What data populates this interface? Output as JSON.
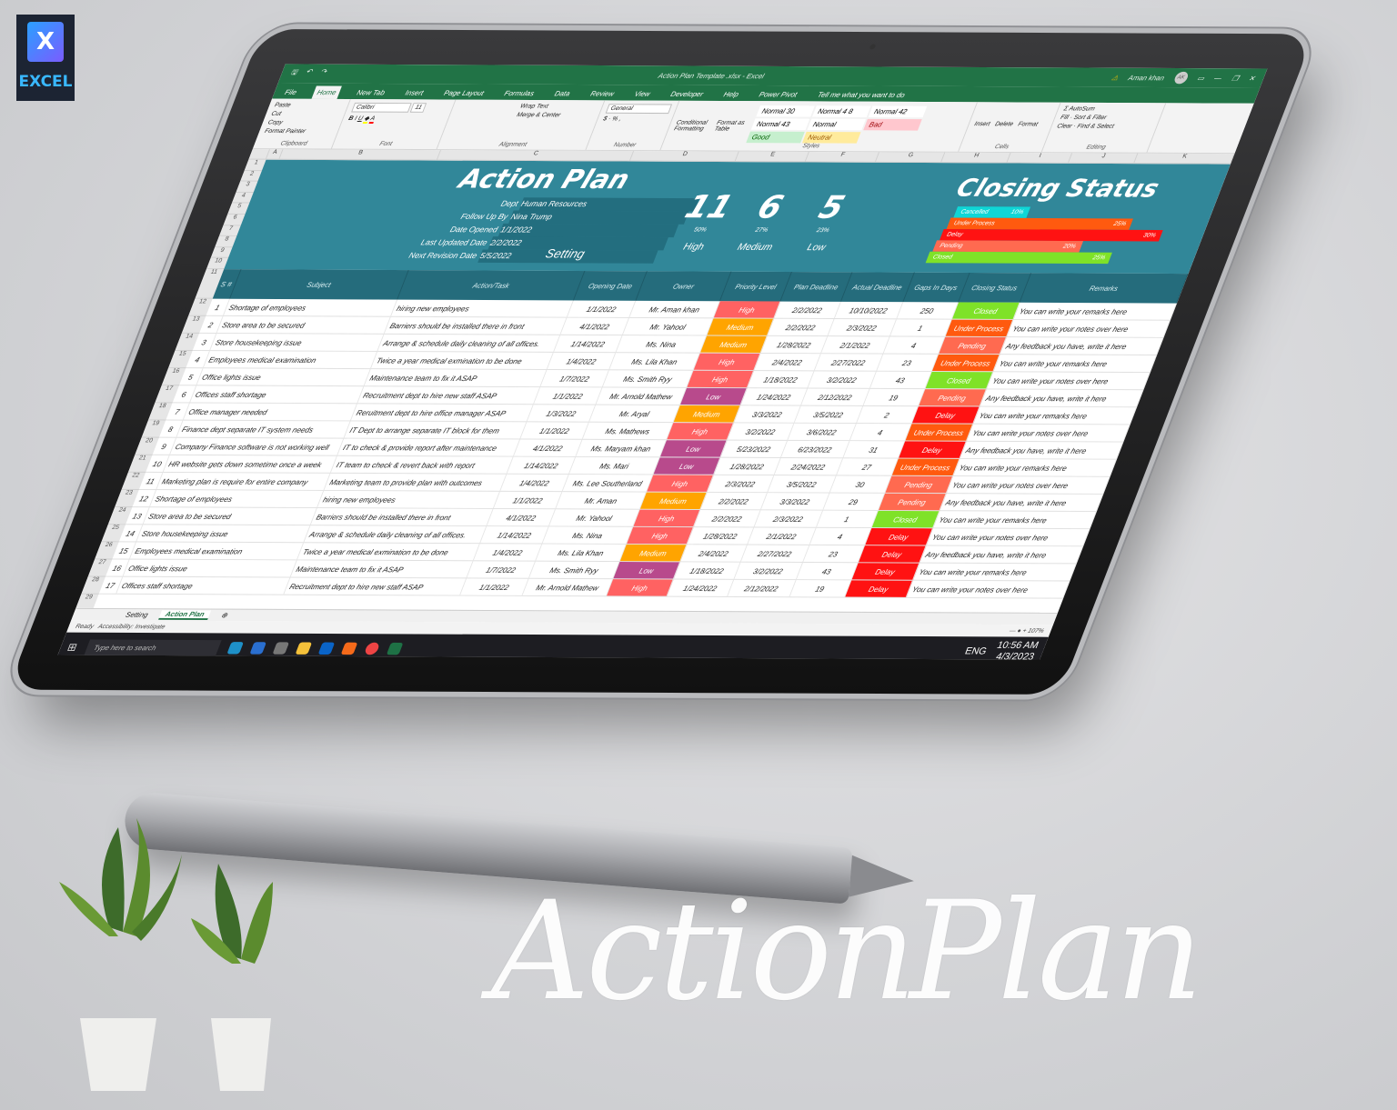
{
  "brand": {
    "logo_letter": "X",
    "logo_label": "EXCEL"
  },
  "window": {
    "file_name": "Action Plan Template .xlsx - Excel",
    "user": "Aman khan",
    "user_initials": "AK"
  },
  "ribbon_tabs": [
    "File",
    "Home",
    "New Tab",
    "Insert",
    "Page Layout",
    "Formulas",
    "Data",
    "Review",
    "View",
    "Developer",
    "Help",
    "Power Pivot",
    "Tell me what you want to do"
  ],
  "ribbon": {
    "clipboard": {
      "paste": "Paste",
      "cut": "Cut",
      "copy": "Copy",
      "format_painter": "Format Painter",
      "label": "Clipboard"
    },
    "font": {
      "name": "Calibri",
      "size": "11",
      "label": "Font"
    },
    "alignment": {
      "wrap": "Wrap Text",
      "merge": "Merge & Center",
      "label": "Alignment"
    },
    "number": {
      "format": "General",
      "label": "Number"
    },
    "styles": {
      "cond": "Conditional Formatting",
      "table": "Format as Table",
      "cells": [
        "Normal 30",
        "Normal 4 8",
        "Normal 42",
        "Normal 43",
        "Normal",
        "Bad",
        "Good",
        "Neutral"
      ],
      "label": "Styles"
    },
    "cells": {
      "insert": "Insert",
      "delete": "Delete",
      "format": "Format",
      "label": "Cells"
    },
    "editing": {
      "autosum": "AutoSum",
      "fill": "Fill",
      "clear": "Clear",
      "sort": "Sort & Filter",
      "find": "Find & Select",
      "label": "Editing"
    }
  },
  "columns": [
    "A",
    "B",
    "C",
    "D",
    "E",
    "F",
    "G",
    "H",
    "I",
    "J",
    "K"
  ],
  "dashboard": {
    "title": "Action Plan",
    "info": [
      {
        "k": "Dept",
        "v": "Human Resources"
      },
      {
        "k": "Follow Up By",
        "v": "Nina Trump"
      },
      {
        "k": "Date Opened",
        "v": "1/1/2022"
      },
      {
        "k": "Last Updated Date",
        "v": "2/2/2022"
      },
      {
        "k": "Next Revision Date",
        "v": "5/5/2022"
      }
    ],
    "setting": "Setting",
    "kpis": [
      {
        "n": "11",
        "p": "50%",
        "l": "High"
      },
      {
        "n": "6",
        "p": "27%",
        "l": "Medium"
      },
      {
        "n": "5",
        "p": "23%",
        "l": "Low"
      }
    ],
    "closing_title": "Closing Status",
    "closing": [
      {
        "label": "Cancelled",
        "pct": 10,
        "color": "#0fd6d6"
      },
      {
        "label": "Under Process",
        "pct": 25,
        "color": "#ff5a0f"
      },
      {
        "label": "Delay",
        "pct": 30,
        "color": "#ff1212"
      },
      {
        "label": "Pending",
        "pct": 20,
        "color": "#ff6a50"
      },
      {
        "label": "Closed",
        "pct": 25,
        "color": "#7fe228"
      }
    ]
  },
  "colors": {
    "High": "#ff6262",
    "Medium": "#ffa400",
    "Low": "#b84a8c",
    "Closed": "#7fe228",
    "Under Process": "#ff5a0f",
    "Pending": "#ff6a50",
    "Delay": "#ff1212",
    "Cancelled": "#0fd6d6"
  },
  "table": {
    "headers": [
      "S #",
      "Subject",
      "Action/Task",
      "Opening Date",
      "Owner",
      "Priority Level",
      "Plan Deadline",
      "Actual Deadline",
      "Gaps In Days",
      "Closing Status",
      "Remarks"
    ],
    "rows": [
      [
        "1",
        "Shortage of employees",
        "hiring new employees",
        "1/1/2022",
        "Mr. Aman khan",
        "High",
        "2/2/2022",
        "10/10/2022",
        "250",
        "Closed",
        "You can write your remarks here"
      ],
      [
        "2",
        "Store area to be secured",
        "Barriers should be installed there in front",
        "4/1/2022",
        "Mr. Yahool",
        "Medium",
        "2/2/2022",
        "2/3/2022",
        "1",
        "Under Process",
        "You can write your notes over here"
      ],
      [
        "3",
        "Store housekeeping issue",
        "Arrange & schedule daily cleaning of all offices.",
        "1/14/2022",
        "Ms. Nina",
        "Medium",
        "1/28/2022",
        "2/1/2022",
        "4",
        "Pending",
        "Any feedback you have, write it here"
      ],
      [
        "4",
        "Employees medical examination",
        "Twice a year medical exmination to be done",
        "1/4/2022",
        "Ms. Lila Khan",
        "High",
        "2/4/2022",
        "2/27/2022",
        "23",
        "Under Process",
        "You can write your remarks here"
      ],
      [
        "5",
        "Office lights issue",
        "Maintenance team to fix it ASAP",
        "1/7/2022",
        "Ms. Smith Ryy",
        "High",
        "1/18/2022",
        "3/2/2022",
        "43",
        "Closed",
        "You can write your notes over here"
      ],
      [
        "6",
        "Offices staff shortage",
        "Recruitment dept to hire new staff ASAP",
        "1/1/2022",
        "Mr. Arnold Mathew",
        "Low",
        "1/24/2022",
        "2/12/2022",
        "19",
        "Pending",
        "Any feedback you have, write it here"
      ],
      [
        "7",
        "Office manager needed",
        "Reruitment dept to hire office manager ASAP",
        "1/3/2022",
        "Mr. Aryal",
        "Medium",
        "3/3/2022",
        "3/5/2022",
        "2",
        "Delay",
        "You can write your remarks here"
      ],
      [
        "8",
        "Finance dept separate IT system needs",
        "IT Dept to arrange separate IT block for them",
        "1/1/2022",
        "Ms. Mathews",
        "High",
        "3/2/2022",
        "3/6/2022",
        "4",
        "Under Process",
        "You can write your notes over here"
      ],
      [
        "9",
        "Company Finance software is not working well",
        "IT to check & provide report after maintenance",
        "4/1/2022",
        "Ms. Maryam khan",
        "Low",
        "5/23/2022",
        "6/23/2022",
        "31",
        "Delay",
        "Any feedback you have, write it here"
      ],
      [
        "10",
        "HR website gets down sometime once a week",
        "IT team to check & revert back with report",
        "1/14/2022",
        "Ms. Mari",
        "Low",
        "1/28/2022",
        "2/24/2022",
        "27",
        "Under Process",
        "You can write your remarks here"
      ],
      [
        "11",
        "Marketing plan is require for entire company",
        "Marketing team to provide plan with outcomes",
        "1/4/2022",
        "Ms. Lee Southerland",
        "High",
        "2/3/2022",
        "3/5/2022",
        "30",
        "Pending",
        "You can write your notes over here"
      ],
      [
        "12",
        "Shortage of employees",
        "hiring new employees",
        "1/1/2022",
        "Mr. Aman",
        "Medium",
        "2/2/2022",
        "3/3/2022",
        "29",
        "Pending",
        "Any feedback you have, write it here"
      ],
      [
        "13",
        "Store area to be secured",
        "Barriers should be installed there in front",
        "4/1/2022",
        "Mr. Yahool",
        "High",
        "2/2/2022",
        "2/3/2022",
        "1",
        "Closed",
        "You can write your remarks here"
      ],
      [
        "14",
        "Store housekeeping issue",
        "Arrange & schedule daily cleaning of all offices.",
        "1/14/2022",
        "Ms. Nina",
        "High",
        "1/28/2022",
        "2/1/2022",
        "4",
        "Delay",
        "You can write your notes over here"
      ],
      [
        "15",
        "Employees medical examination",
        "Twice a year medical exmination to be done",
        "1/4/2022",
        "Ms. Lila Khan",
        "Medium",
        "2/4/2022",
        "2/27/2022",
        "23",
        "Delay",
        "Any feedback you have, write it here"
      ],
      [
        "16",
        "Office lights issue",
        "Maintenance team to fix it ASAP",
        "1/7/2022",
        "Ms. Smith Ryy",
        "Low",
        "1/18/2022",
        "3/2/2022",
        "43",
        "Delay",
        "You can write your remarks here"
      ],
      [
        "17",
        "Offices staff shortage",
        "Recruitment dept to hire new staff ASAP",
        "1/1/2022",
        "Mr. Arnold Mathew",
        "High",
        "1/24/2022",
        "2/12/2022",
        "19",
        "Delay",
        "You can write your notes over here"
      ]
    ]
  },
  "sheet_tabs": [
    "Setting",
    "Action Plan"
  ],
  "status": {
    "ready": "Ready",
    "accessibility": "Accessibility: Investigate",
    "zoom": "107%"
  },
  "taskbar": {
    "search": "Type here to search",
    "lang": "ENG",
    "time": "10:56 AM",
    "date": "4/3/2023"
  },
  "overlay_text": {
    "word1": "Action",
    "word2": "Plan"
  }
}
